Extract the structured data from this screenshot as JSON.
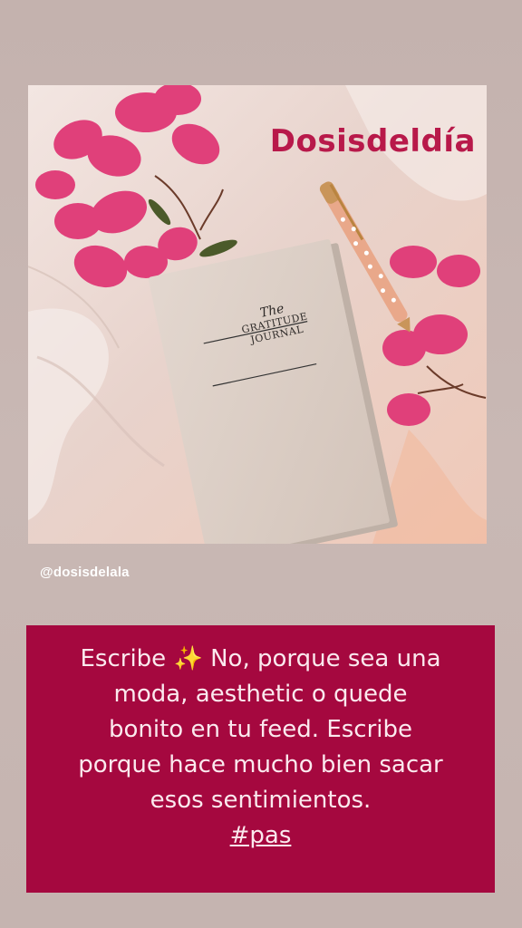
{
  "photo": {
    "brand_text": "Dosisdeldía",
    "book_title_line1": "The",
    "book_title_line2": "GRATITUDE",
    "book_title_line3": "JOURNAL"
  },
  "mention": "@dosisdelala",
  "caption": {
    "line1_pre": "Escribe",
    "sparkle": "✨",
    "line1_post": "No, porque sea una",
    "line2": "moda, aesthetic o quede",
    "line3": "bonito en tu feed. Escribe",
    "line4": "porque hace mucho bien sacar",
    "line5": "esos sentimientos.",
    "hashtag": "#pas"
  },
  "colors": {
    "background": "#c8b7b3",
    "caption_box": "#a5083f",
    "brand": "#b8194a",
    "flower": "#e0407a"
  }
}
